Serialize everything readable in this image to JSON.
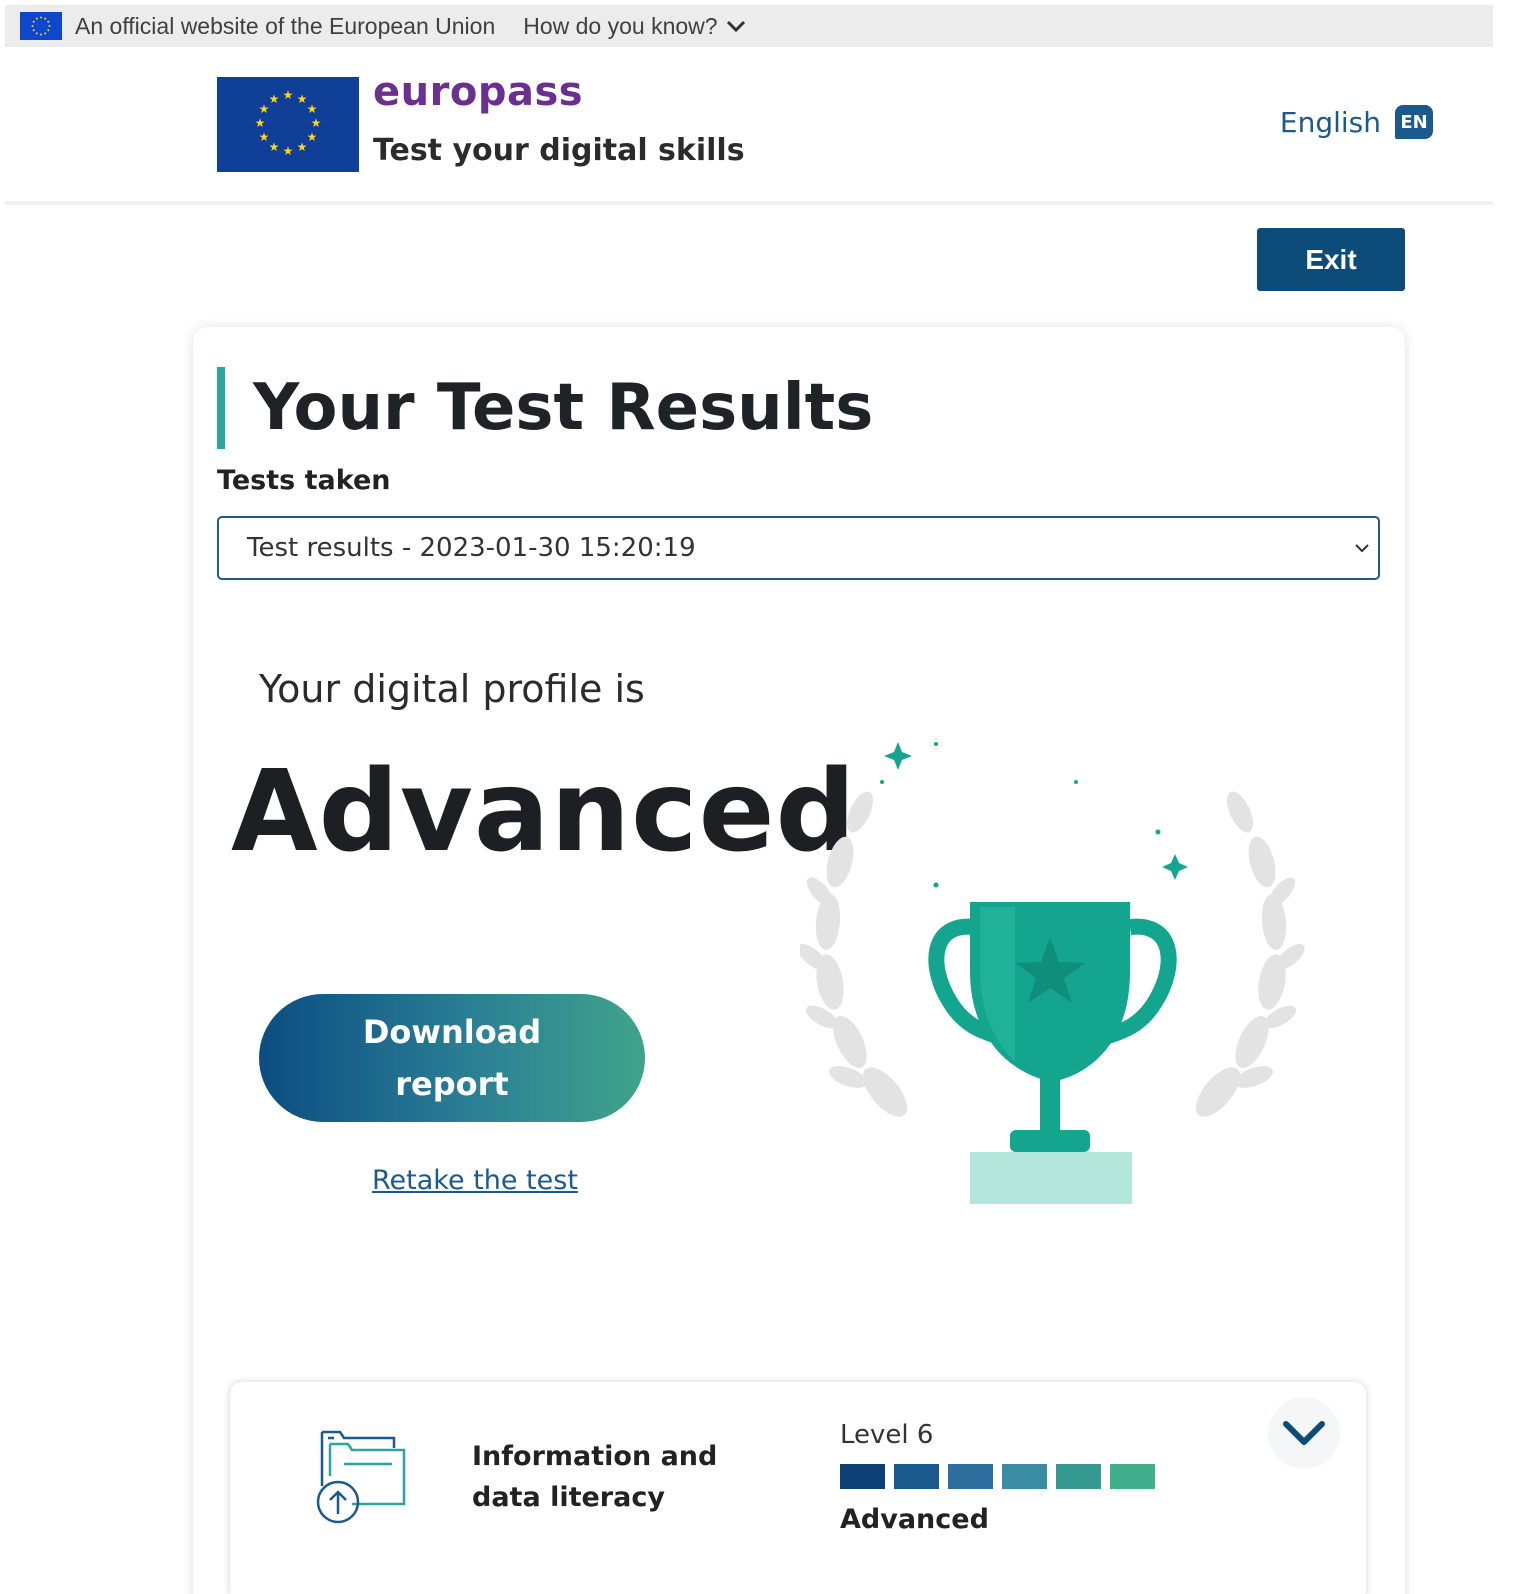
{
  "eu_banner": {
    "text": "An official website of the European Union",
    "how_label": "How do you know?"
  },
  "header": {
    "brand": "europass",
    "subtitle": "Test your digital skills",
    "language": "English",
    "language_code": "EN"
  },
  "exit_label": "Exit",
  "results": {
    "title": "Your Test Results",
    "tests_taken_label": "Tests taken",
    "selected_test": "Test results - 2023-01-30 15:20:19",
    "profile_intro": "Your digital profile is",
    "profile_level": "Advanced",
    "download_line1": "Download",
    "download_line2": "report",
    "retake_label": "Retake the test"
  },
  "skills": [
    {
      "name": "Information and data literacy",
      "level_label": "Level 6",
      "rating": "Advanced",
      "level_value": 6,
      "level_max": 6
    }
  ],
  "colors": {
    "primary": "#0d4b79",
    "brand_purple": "#6b2f8f",
    "accent_teal": "#2aa6a0",
    "trophy": "#14a58f",
    "level_bars": [
      "#0c3f73",
      "#1b5a8c",
      "#2e6fa0",
      "#3a8ca5",
      "#36998f",
      "#3fb08b"
    ]
  },
  "icons": {
    "eu_flag": "eu-flag-icon",
    "chevron": "chevron-down-icon",
    "trophy": "trophy-illustration",
    "skill": "folder-upload-icon"
  }
}
